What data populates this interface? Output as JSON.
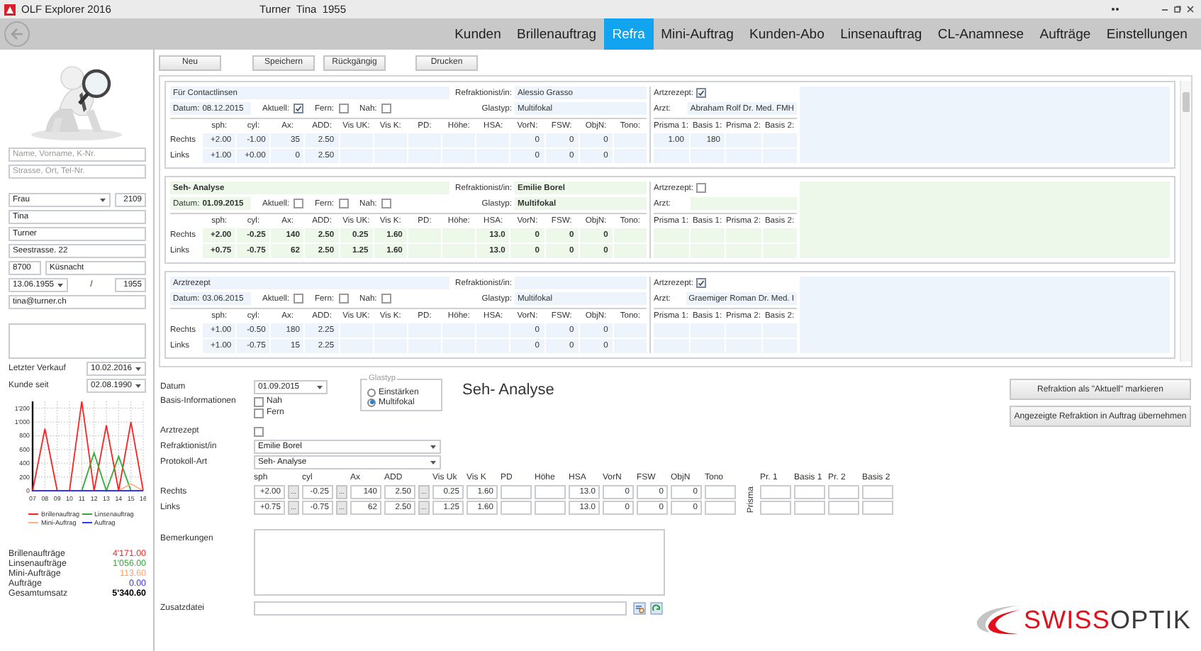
{
  "window": {
    "title": "OLF Explorer 2016",
    "customer": "Turner  Tina  1955"
  },
  "nav": {
    "tabs": [
      {
        "label": "Kunden",
        "selected": false
      },
      {
        "label": "Brillenauftrag",
        "selected": false
      },
      {
        "label": "Refra",
        "selected": true
      },
      {
        "label": "Mini-Auftrag",
        "selected": false
      },
      {
        "label": "Kunden-Abo",
        "selected": false
      },
      {
        "label": "Linsenauftrag",
        "selected": false
      },
      {
        "label": "CL-Anamnese",
        "selected": false
      },
      {
        "label": "Aufträge",
        "selected": false
      },
      {
        "label": "Einstellungen",
        "selected": false
      }
    ]
  },
  "sidebar": {
    "search_fields": [
      {
        "placeholder": "Name, Vorname, K-Nr."
      },
      {
        "placeholder": "Strasse, Ort, Tel-Nr."
      }
    ],
    "salutation": "Frau",
    "customer_number": "2109",
    "first_name": "Tina",
    "last_name": "Turner",
    "street": "Seestrasse. 22",
    "zip": "8700",
    "city": "Küsnacht",
    "birth_date": "13.06.1955",
    "date_separator": "/",
    "birth_year": "1955",
    "email": "tina@turner.ch",
    "dates": [
      {
        "label": "Letzter Verkauf",
        "value": "10.02.2016"
      },
      {
        "label": "Kunde seit",
        "value": "02.08.1990"
      }
    ],
    "chart_data": {
      "type": "line",
      "grid": true,
      "categories": [
        "07",
        "08",
        "09",
        "10",
        "11",
        "12",
        "13",
        "14",
        "15",
        "16"
      ],
      "ylim": [
        0,
        1300
      ],
      "yticks": [
        0,
        200,
        400,
        600,
        800,
        {
          "value": 1000,
          "label": "1'000"
        },
        {
          "value": 1200,
          "label": "1'200"
        }
      ],
      "series": [
        {
          "name": "Brillenauftrag",
          "color": "#ff2020",
          "values": [
            0,
            900,
            0,
            0,
            1300,
            0,
            950,
            0,
            1000,
            0
          ]
        },
        {
          "name": "Linsenauftrag",
          "color": "#33aa33",
          "values": [
            null,
            null,
            null,
            null,
            0,
            550,
            0,
            500,
            0,
            null
          ]
        },
        {
          "name": "Mini-Auftrag",
          "color": "#ffb088",
          "values": [
            null,
            null,
            null,
            null,
            null,
            null,
            null,
            0,
            100,
            0
          ]
        },
        {
          "name": "Auftrag",
          "color": "#3333ff",
          "values": [
            0,
            0,
            0,
            0,
            0,
            0,
            0,
            0,
            0,
            0
          ]
        }
      ]
    },
    "totals": [
      {
        "label": "Brillenaufträge",
        "value": "4'171.00",
        "color": "#ff2020",
        "kind": "line"
      },
      {
        "label": "Linsenaufträge",
        "value": "1'056.00",
        "color": "#33aa33",
        "kind": "line"
      },
      {
        "label": "Mini-Aufträge",
        "value": "113.60",
        "color": "#ffa070",
        "kind": "line"
      },
      {
        "label": "Aufträge",
        "value": "0.00",
        "color": "#3333ff",
        "kind": "line"
      },
      {
        "label": "Gesamtumsatz",
        "value": "5'340.60",
        "color": "#000000",
        "kind": "total"
      }
    ]
  },
  "toolbar": [
    "Neu",
    "Speichern",
    "Rückgängig",
    "Drucken"
  ],
  "cards": [
    {
      "selected": false,
      "title": "Für Contactlinsen",
      "refraktionist_label": "Refraktionist/in:",
      "refraktionist": "Alessio Grasso",
      "datum_label": "Datum:",
      "datum": "08.12.2015",
      "aktuell_label": "Aktuell:",
      "aktuell": true,
      "fern_label": "Fern:",
      "fern": false,
      "nah_label": "Nah:",
      "nah": false,
      "glastyp_label": "Glastyp:",
      "glastyp": "Multifokal",
      "columns": [
        "sph:",
        "cyl:",
        "Ax:",
        "ADD:",
        "Vis UK:",
        "Vis K:",
        "PD:",
        "Höhe:",
        "HSA:",
        "VorN:",
        "FSW:",
        "ObjN:",
        "Tono:"
      ],
      "rows": [
        {
          "label": "Rechts",
          "values": {
            "sph": "+2.00",
            "cyl": "-1.00",
            "ax": "35",
            "add": "2.50",
            "vorn": "0",
            "fsw": "0",
            "objn": "0"
          },
          "prisma": {
            "prisma_1": "1.00",
            "basis_1": "180"
          }
        },
        {
          "label": "Links",
          "values": {
            "sph": "+1.00",
            "cyl": "+0.00",
            "ax": "0",
            "add": "2.50",
            "vorn": "0",
            "fsw": "0",
            "objn": "0"
          }
        }
      ],
      "arztrezept_label": "Artzrezept:",
      "arztrezept": true,
      "arzt_label": "Arzt:",
      "arzt": "Abraham Rolf Dr. Med. FMH",
      "prisma_columns": [
        "Prisma 1:",
        "Basis 1:",
        "Prisma 2:",
        "Basis 2:"
      ]
    },
    {
      "selected": true,
      "title": "Seh- Analyse",
      "refraktionist_label": "Refraktionist/in:",
      "refraktionist": "Emilie Borel",
      "datum_label": "Datum:",
      "datum": "01.09.2015",
      "aktuell_label": "Aktuell:",
      "aktuell": false,
      "fern_label": "Fern:",
      "fern": false,
      "nah_label": "Nah:",
      "nah": false,
      "glastyp_label": "Glastyp:",
      "glastyp": "Multifokal",
      "columns": [
        "sph:",
        "cyl:",
        "Ax:",
        "ADD:",
        "Vis UK:",
        "Vis K:",
        "PD:",
        "Höhe:",
        "HSA:",
        "VorN:",
        "FSW:",
        "ObjN:",
        "Tono:"
      ],
      "rows": [
        {
          "label": "Rechts",
          "values": {
            "sph": "+2.00",
            "cyl": "-0.25",
            "ax": "140",
            "add": "2.50",
            "vis_uk": "0.25",
            "vis_k": "1.60",
            "hsa": "13.0",
            "vorn": "0",
            "fsw": "0",
            "objn": "0"
          }
        },
        {
          "label": "Links",
          "values": {
            "sph": "+0.75",
            "cyl": "-0.75",
            "ax": "62",
            "add": "2.50",
            "vis_uk": "1.25",
            "vis_k": "1.60",
            "hsa": "13.0",
            "vorn": "0",
            "fsw": "0",
            "objn": "0"
          }
        }
      ],
      "arztrezept_label": "Artzrezept:",
      "arztrezept": false,
      "arzt_label": "Arzt:",
      "prisma_columns": [
        "Prisma 1:",
        "Basis 1:",
        "Prisma 2:",
        "Basis 2:"
      ]
    },
    {
      "selected": false,
      "title": "Arztrezept",
      "refraktionist_label": "Refraktionist/in:",
      "datum_label": "Datum:",
      "datum": "03.06.2015",
      "aktuell_label": "Aktuell:",
      "aktuell": false,
      "fern_label": "Fern:",
      "fern": false,
      "nah_label": "Nah:",
      "nah": false,
      "glastyp_label": "Glastyp:",
      "glastyp": "Multifokal",
      "columns": [
        "sph:",
        "cyl:",
        "Ax:",
        "ADD:",
        "Vis UK:",
        "Vis K:",
        "PD:",
        "Höhe:",
        "HSA:",
        "VorN:",
        "FSW:",
        "ObjN:",
        "Tono:"
      ],
      "rows": [
        {
          "label": "Rechts",
          "values": {
            "sph": "+1.00",
            "cyl": "-0.50",
            "ax": "180",
            "add": "2.25",
            "vorn": "0",
            "fsw": "0",
            "objn": "0"
          }
        },
        {
          "label": "Links",
          "values": {
            "sph": "+1.00",
            "cyl": "-0.75",
            "ax": "15",
            "add": "2.25",
            "vorn": "0",
            "fsw": "0",
            "objn": "0"
          }
        }
      ],
      "arztrezept_label": "Artzrezept:",
      "arztrezept": true,
      "arzt_label": "Arzt:",
      "arzt": "Graemiger Roman Dr. Med. I",
      "prisma_columns": [
        "Prisma 1:",
        "Basis 1:",
        "Prisma 2:",
        "Basis 2:"
      ]
    }
  ],
  "detail": {
    "datum_label": "Datum",
    "datum": "01.09.2015",
    "basis_label": "Basis-Informationen",
    "nah": {
      "label": "Nah",
      "checked": false
    },
    "fern": {
      "label": "Fern",
      "checked": false
    },
    "glastyp": {
      "legend": "Glastyp",
      "options": [
        {
          "label": "Einstärken",
          "selected": false
        },
        {
          "label": "Multifokal",
          "selected": true
        }
      ]
    },
    "heading": "Seh- Analyse",
    "arztrezept": {
      "label": "Arztrezept",
      "checked": false
    },
    "refraktionist": {
      "label": "Refraktionist/in",
      "value": "Emilie Borel"
    },
    "protokoll": {
      "label": "Protokoll-Art",
      "value": "Seh- Analyse"
    },
    "columns": [
      "sph",
      "cyl",
      "Ax",
      "ADD",
      "Vis Uk",
      "Vis K",
      "PD",
      "Höhe",
      "HSA",
      "VorN",
      "FSW",
      "ObjN",
      "Tono"
    ],
    "rows": [
      {
        "label": "Rechts",
        "values": {
          "sph": "+2.00",
          "cyl": "-0.25",
          "ax": "140",
          "add": "2.50",
          "vis_uk": "0.25",
          "vis_k": "1.60",
          "hsa": "13.0",
          "vorn": "0",
          "fsw": "0",
          "objn": "0"
        },
        "buttons": {
          "sph": "...",
          "cyl": "...",
          "add": "..."
        }
      },
      {
        "label": "Links",
        "values": {
          "sph": "+0.75",
          "cyl": "-0.75",
          "ax": "62",
          "add": "2.50",
          "vis_uk": "1.25",
          "vis_k": "1.60",
          "hsa": "13.0",
          "vorn": "0",
          "fsw": "0",
          "objn": "0"
        },
        "buttons": {
          "sph": "...",
          "cyl": "...",
          "add": "..."
        }
      }
    ],
    "prisma_label": "Prisma",
    "prisma_columns": [
      "Pr. 1",
      "Basis 1",
      "Pr. 2",
      "Basis 2"
    ],
    "bemerkungen_label": "Bemerkungen",
    "zusatzdatei_label": "Zusatzdatei",
    "actions": [
      "Refraktion als \"Aktuell\" markieren",
      "Angezeigte Refraktion in Auftrag übernehmen"
    ],
    "logo": {
      "accent": "SWISS",
      "rest": "OPTIK"
    }
  }
}
